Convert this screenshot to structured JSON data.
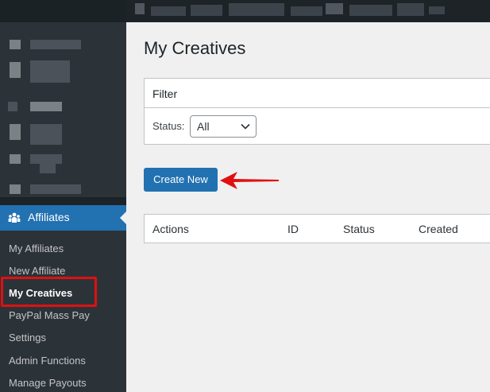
{
  "sidebar": {
    "menu_label": "Affiliates",
    "submenu": [
      {
        "label": "My Affiliates",
        "current": false
      },
      {
        "label": "New Affiliate",
        "current": false
      },
      {
        "label": "My Creatives",
        "current": true
      },
      {
        "label": "PayPal Mass Pay",
        "current": false
      },
      {
        "label": "Settings",
        "current": false
      },
      {
        "label": "Admin Functions",
        "current": false
      },
      {
        "label": "Manage Payouts",
        "current": false
      }
    ]
  },
  "main": {
    "title": "My Creatives",
    "filter": {
      "title": "Filter",
      "status_label": "Status:",
      "status_value": "All"
    },
    "create_button": "Create New",
    "table": {
      "columns": [
        "Actions",
        "ID",
        "Status",
        "Created"
      ]
    }
  },
  "colors": {
    "accent": "#2271b1",
    "sidebar_bg": "#1d2327",
    "highlight": "#e01010"
  },
  "icons": {
    "affiliates": "people-group-icon",
    "select_arrow": "chevron-down-icon",
    "annotation": "red-arrow-icon"
  }
}
